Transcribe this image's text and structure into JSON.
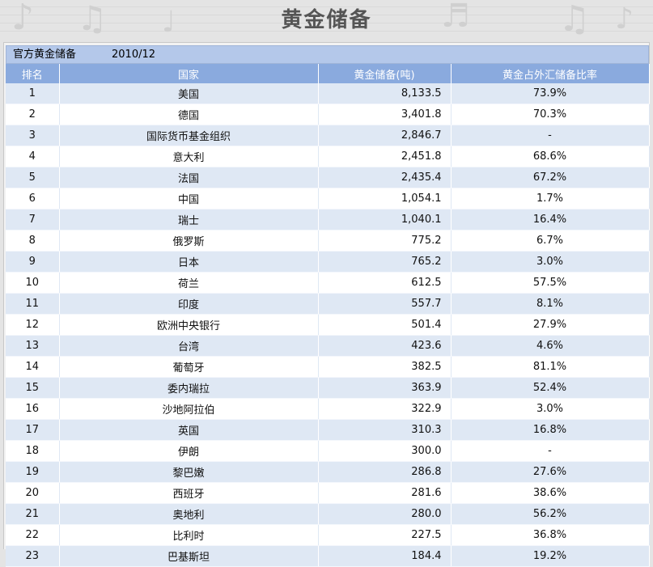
{
  "title": "黄金储备",
  "info": {
    "label": "官方黄金储备",
    "date": "2010/12"
  },
  "columns": [
    "排名",
    "国家",
    "黄金储备(吨)",
    "黄金占外汇储备比率"
  ],
  "rows": [
    {
      "rank": "1",
      "country": "美国",
      "gold": "8,133.5",
      "ratio": "73.9%"
    },
    {
      "rank": "2",
      "country": "德国",
      "gold": "3,401.8",
      "ratio": "70.3%"
    },
    {
      "rank": "3",
      "country": "国际货币基金组织",
      "gold": "2,846.7",
      "ratio": "-"
    },
    {
      "rank": "4",
      "country": "意大利",
      "gold": "2,451.8",
      "ratio": "68.6%"
    },
    {
      "rank": "5",
      "country": "法国",
      "gold": "2,435.4",
      "ratio": "67.2%"
    },
    {
      "rank": "6",
      "country": "中国",
      "gold": "1,054.1",
      "ratio": "1.7%"
    },
    {
      "rank": "7",
      "country": "瑞士",
      "gold": "1,040.1",
      "ratio": "16.4%"
    },
    {
      "rank": "8",
      "country": "俄罗斯",
      "gold": "775.2",
      "ratio": "6.7%"
    },
    {
      "rank": "9",
      "country": "日本",
      "gold": "765.2",
      "ratio": "3.0%"
    },
    {
      "rank": "10",
      "country": "荷兰",
      "gold": "612.5",
      "ratio": "57.5%"
    },
    {
      "rank": "11",
      "country": "印度",
      "gold": "557.7",
      "ratio": "8.1%"
    },
    {
      "rank": "12",
      "country": "欧洲中央银行",
      "gold": "501.4",
      "ratio": "27.9%"
    },
    {
      "rank": "13",
      "country": "台湾",
      "gold": "423.6",
      "ratio": "4.6%"
    },
    {
      "rank": "14",
      "country": "葡萄牙",
      "gold": "382.5",
      "ratio": "81.1%"
    },
    {
      "rank": "15",
      "country": "委内瑞拉",
      "gold": "363.9",
      "ratio": "52.4%"
    },
    {
      "rank": "16",
      "country": "沙地阿拉伯",
      "gold": "322.9",
      "ratio": "3.0%"
    },
    {
      "rank": "17",
      "country": "英国",
      "gold": "310.3",
      "ratio": "16.8%"
    },
    {
      "rank": "18",
      "country": "伊朗",
      "gold": "300.0",
      "ratio": "-"
    },
    {
      "rank": "19",
      "country": "黎巴嫩",
      "gold": "286.8",
      "ratio": "27.6%"
    },
    {
      "rank": "20",
      "country": "西班牙",
      "gold": "281.6",
      "ratio": "38.6%"
    },
    {
      "rank": "21",
      "country": "奥地利",
      "gold": "280.0",
      "ratio": "56.2%"
    },
    {
      "rank": "22",
      "country": "比利时",
      "gold": "227.5",
      "ratio": "36.8%"
    },
    {
      "rank": "23",
      "country": "巴基斯坦",
      "gold": "184.4",
      "ratio": "19.2%"
    }
  ]
}
